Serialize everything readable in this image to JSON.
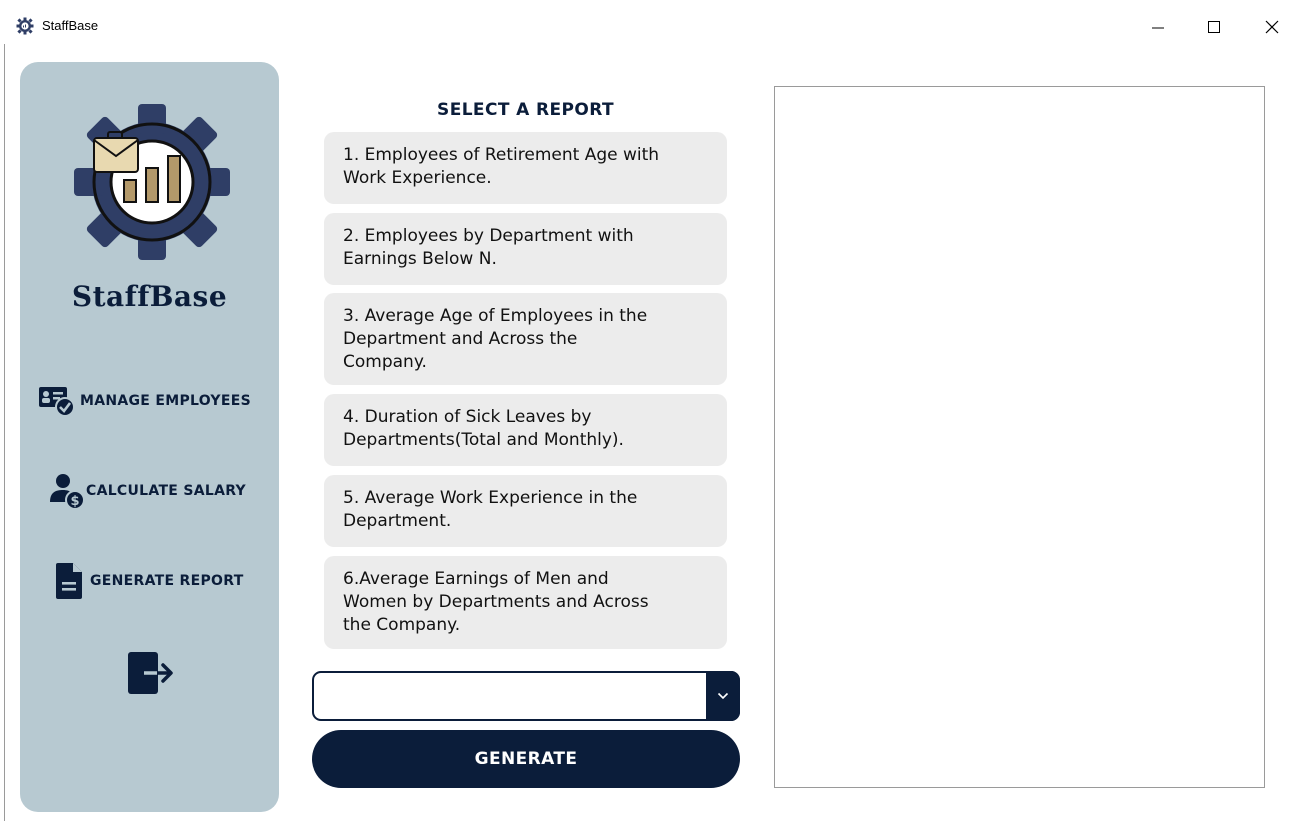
{
  "window": {
    "title": "StaffBase"
  },
  "sidebar": {
    "brand": "StaffBase",
    "items": [
      {
        "label": "MANAGE EMPLOYEES",
        "icon": "id-card-check-icon"
      },
      {
        "label": "CALCULATE SALARY",
        "icon": "user-dollar-icon"
      },
      {
        "label": "GENERATE REPORT",
        "icon": "document-icon"
      },
      {
        "label": "",
        "icon": "logout-icon"
      }
    ]
  },
  "main": {
    "section_title": "SELECT A REPORT",
    "reports": [
      {
        "lines": [
          "1. Employees of Retirement Age with",
          "Work Experience."
        ]
      },
      {
        "lines": [
          "2. Employees by Department with",
          "Earnings Below N."
        ]
      },
      {
        "lines": [
          "3. Average Age of Employees in the",
          "Department and Across the",
          "Company."
        ]
      },
      {
        "lines": [
          "4. Duration of Sick Leaves by",
          "Departments(Total and Monthly)."
        ]
      },
      {
        "lines": [
          "5. Average Work Experience in the",
          "Department."
        ]
      },
      {
        "lines": [
          "6.Average Earnings of Men and",
          "Women by Departments and Across",
          "the Company."
        ]
      }
    ],
    "select": {
      "value": ""
    },
    "generate_label": "GENERATE"
  },
  "colors": {
    "sidebar_bg": "#b7c9d1",
    "accent": "#0b1d3a",
    "card_bg": "#ececec",
    "logo_gear": "#2f3e66",
    "logo_chart": "#b3996a",
    "logo_envelope": "#e8d9b0"
  }
}
